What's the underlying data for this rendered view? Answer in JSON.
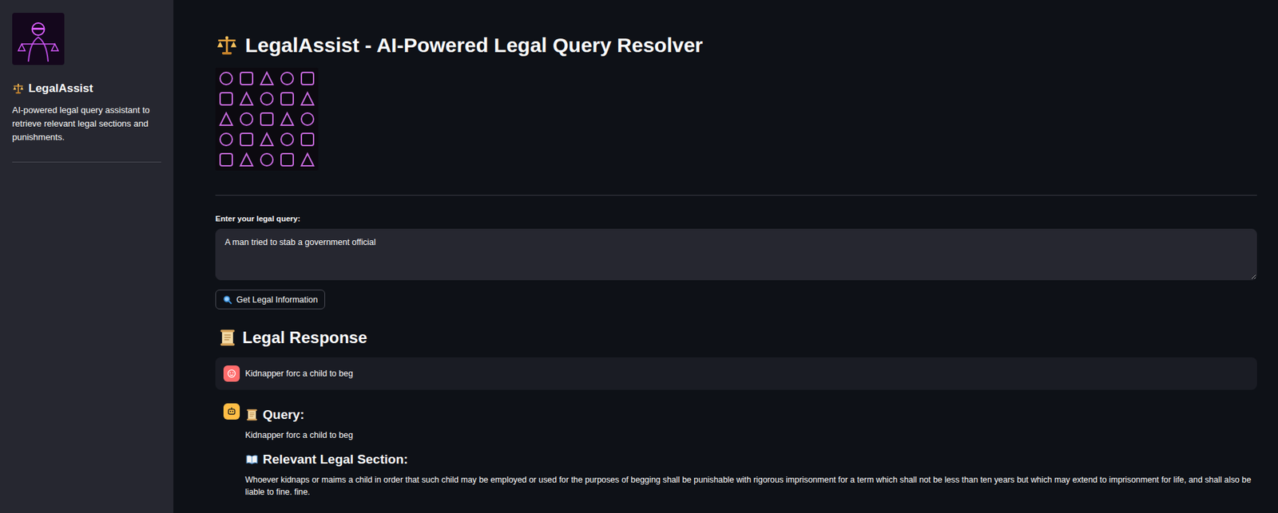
{
  "sidebar": {
    "title": "LegalAssist",
    "description": "AI-powered legal query assistant to retrieve relevant legal sections and punishments."
  },
  "page": {
    "title": "LegalAssist - AI-Powered Legal Query Resolver"
  },
  "query_input": {
    "label": "Enter your legal query:",
    "value": "A man tried to stab a government official"
  },
  "submit_button": {
    "label": "Get Legal Information"
  },
  "response": {
    "title": "Legal Response"
  },
  "messages": [
    {
      "role": "user",
      "kind": "text",
      "text": "Kidnapper forc a child to beg"
    },
    {
      "role": "assistant",
      "kind": "result",
      "query_heading": "Query:",
      "query": "Kidnapper forc a child to beg",
      "section_heading": "Relevant Legal Section:",
      "section": "Whoever kidnaps or maims a child in order that such child may be employed or used for the purposes of begging shall be punishable with rigorous imprisonment for a term which shall not be less than ten years but which may extend to imprisonment for life, and shall also be liable to fine. fine."
    }
  ]
}
